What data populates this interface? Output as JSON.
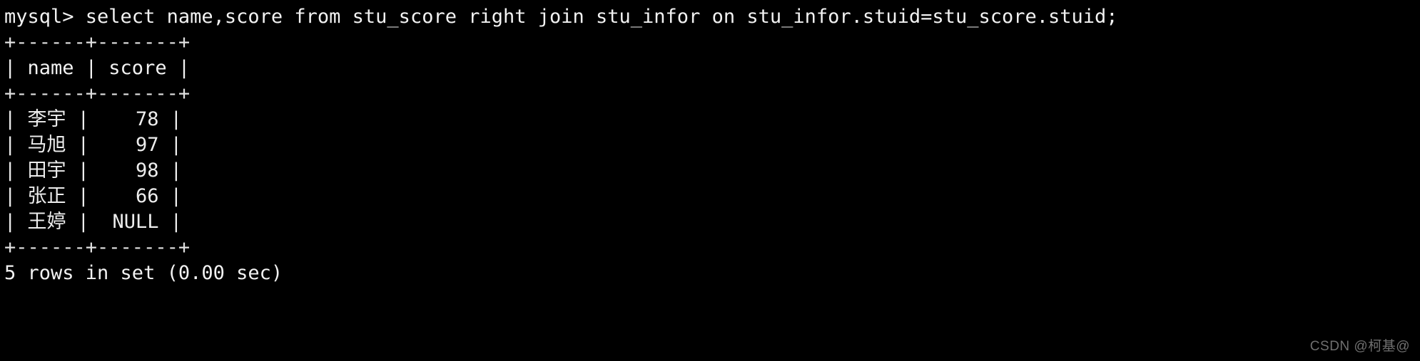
{
  "terminal": {
    "background_color": "#000000",
    "text_color": "#e9e9e9",
    "prompt_line": "mysql> select name,score from stu_score right join stu_infor on stu_infor.stuid=stu_score.stuid;",
    "table": {
      "top_border": "+------+-------+",
      "header_row": "| name | score |",
      "header_separator": "+------+-------+",
      "bottom_border": "+------+-------+",
      "columns": [
        "name",
        "score"
      ],
      "rows": [
        {
          "line": "| 李宇 |    78 |",
          "name": "李宇",
          "score": "78"
        },
        {
          "line": "| 马旭 |    97 |",
          "name": "马旭",
          "score": "97"
        },
        {
          "line": "| 田宇 |    98 |",
          "name": "田宇",
          "score": "98"
        },
        {
          "line": "| 张正 |    66 |",
          "name": "张正",
          "score": "66"
        },
        {
          "line": "| 王婷 |  NULL |",
          "name": "王婷",
          "score": "NULL"
        }
      ]
    },
    "status_line": "5 rows in set (0.00 sec)"
  },
  "watermark": {
    "text": "CSDN @柯基@",
    "color": "#6f6f6f"
  }
}
